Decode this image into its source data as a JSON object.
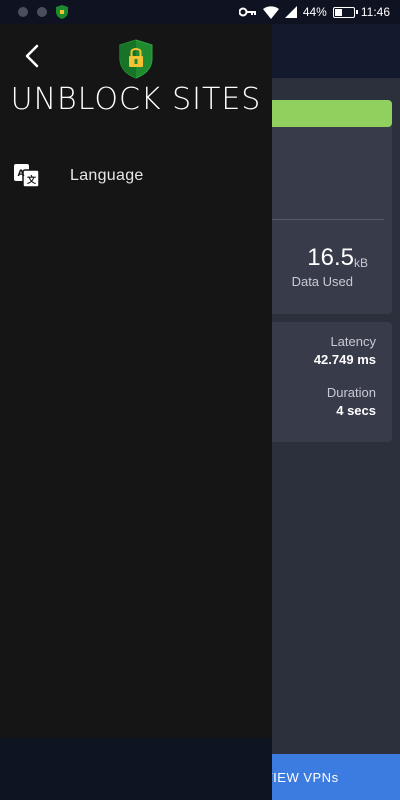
{
  "status_bar": {
    "battery_percent_text": "44%",
    "battery_level": 0.44,
    "time": "11:46",
    "icons": [
      "key-icon",
      "wifi-icon",
      "signal-icon",
      "battery-icon"
    ]
  },
  "drawer": {
    "title": "UNBLOCK SITES",
    "back_icon": "chevron-left-icon",
    "logo": "shield-vpn-logo",
    "menu_items": [
      {
        "label": "Language",
        "icon": "translate-icon"
      }
    ]
  },
  "background_screen": {
    "data_used": {
      "value": "16.5",
      "unit": "kB",
      "label": "Data Used"
    },
    "latency": {
      "label": "Latency",
      "value": "42.749 ms"
    },
    "duration": {
      "label": "Duration",
      "value": "4 secs"
    },
    "view_button_label": "VIEW VPNs",
    "accent_green": "#8fd05e",
    "accent_blue": "#3c7be0"
  }
}
